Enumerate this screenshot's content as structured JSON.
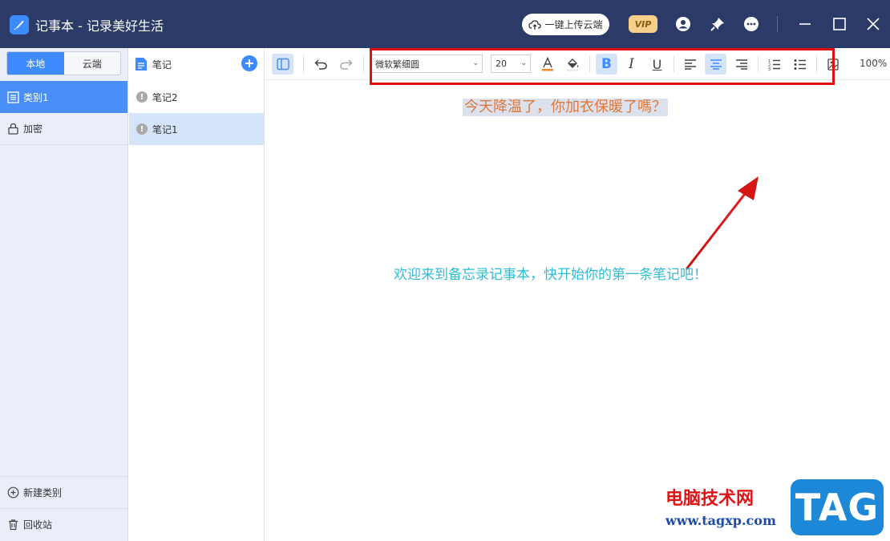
{
  "window": {
    "title": "记事本 - 记录美好生活",
    "upload_label": "一键上传云端",
    "vip_label": "VIP"
  },
  "sidebar": {
    "tabs": [
      {
        "label": "本地",
        "active": true
      },
      {
        "label": "云端",
        "active": false
      }
    ],
    "items": [
      {
        "label": "类别1",
        "active": true
      },
      {
        "label": "加密",
        "active": false
      }
    ],
    "new_category_label": "新建类别",
    "recycle_label": "回收站"
  },
  "notes": {
    "header_label": "笔记",
    "items": [
      {
        "label": "笔记2",
        "active": false
      },
      {
        "label": "笔记1",
        "active": true
      }
    ]
  },
  "toolbar": {
    "font_name": "微软繁细圆",
    "font_size": "20",
    "bold_label": "B",
    "italic_label": "I",
    "underline_label": "U",
    "zoom": "100%"
  },
  "editor": {
    "content_line": "今天降温了，你加衣保暖了嗎？",
    "welcome": "欢迎来到备忘录记事本，快开始你的第一条笔记吧！"
  },
  "watermark": {
    "site_name": "电脑技术网",
    "url": "www.tagxp.com",
    "tag": "TAG"
  },
  "colors": {
    "titlebar": "#2b3a67",
    "accent": "#3d8bff",
    "content_text": "#e0773a",
    "welcome_text": "#2fbcd8",
    "annotation": "#e01010"
  }
}
